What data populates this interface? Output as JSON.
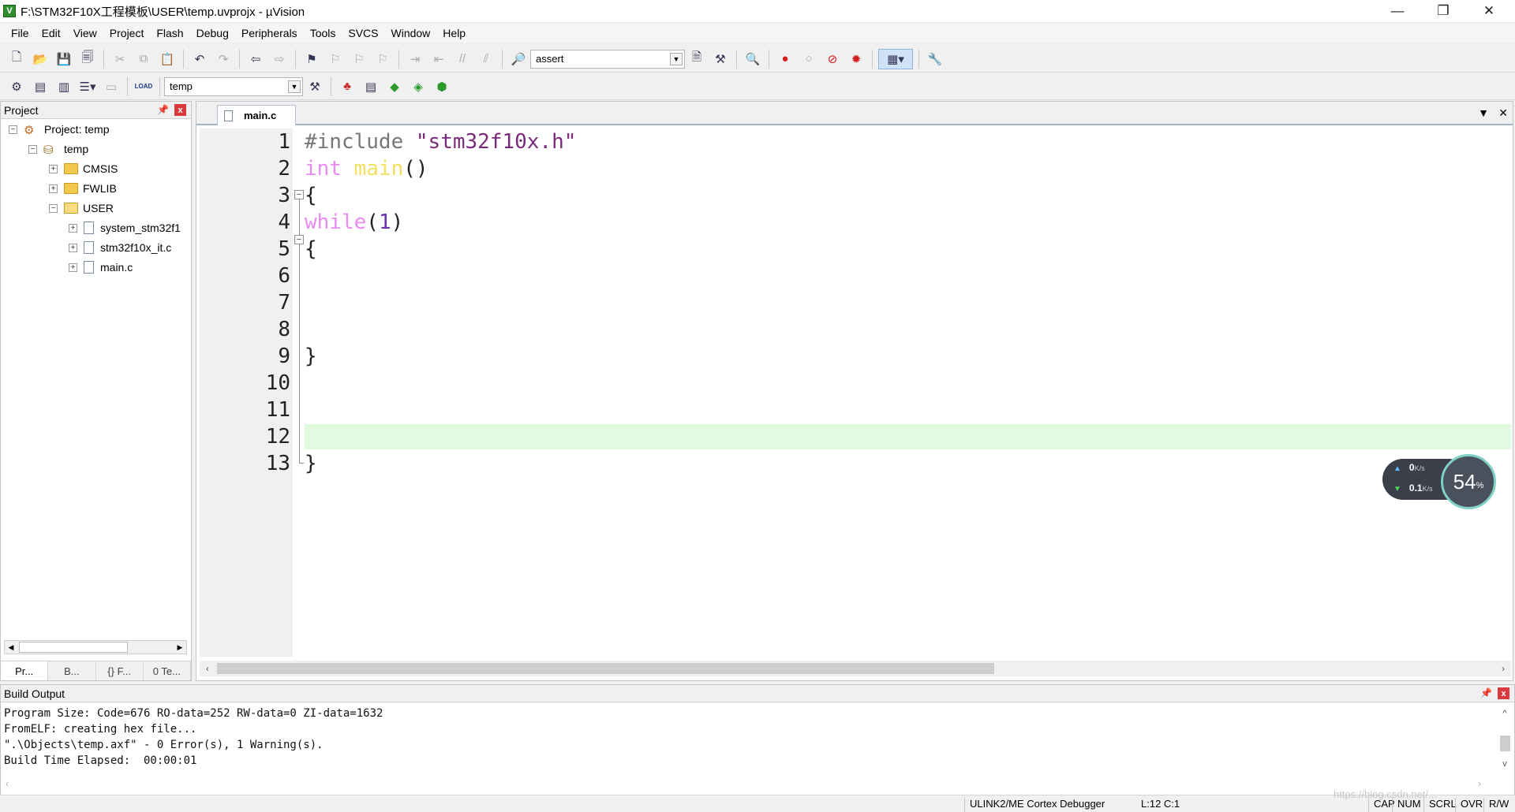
{
  "window": {
    "title": "F:\\STM32F10X工程模板\\USER\\temp.uvprojx - µVision",
    "minimize": "—",
    "maximize": "❐",
    "close": "✕"
  },
  "menu": [
    "File",
    "Edit",
    "View",
    "Project",
    "Flash",
    "Debug",
    "Peripherals",
    "Tools",
    "SVCS",
    "Window",
    "Help"
  ],
  "toolbar1": {
    "find_combo_value": "assert"
  },
  "toolbar2": {
    "target_combo_value": "temp",
    "load_label": "LOAD"
  },
  "project_panel": {
    "title": "Project",
    "pin": "📌",
    "close": "x",
    "root": "Project: temp",
    "target": "temp",
    "groups": [
      "CMSIS",
      "FWLIB",
      "USER"
    ],
    "user_files": [
      "system_stm32f1",
      "stm32f10x_it.c",
      "main.c"
    ],
    "tabs": [
      "Pr...",
      "B...",
      "{} F...",
      "0 Te..."
    ]
  },
  "editor": {
    "active_tab": "main.c",
    "line_numbers": [
      "1",
      "2",
      "3",
      "4",
      "5",
      "6",
      "7",
      "8",
      "9",
      "10",
      "11",
      "12",
      "13"
    ],
    "code": {
      "l1_pp": "#include",
      "l1_str": "\"stm32f10x.h\"",
      "l2_kw": "int",
      "l2_fn": "main",
      "l2_pun": "()",
      "l3": "{",
      "l4_kw": "while",
      "l4_open": "(",
      "l4_num": "1",
      "l4_close": ")",
      "l5": "{",
      "l9": "}",
      "l13": "}"
    }
  },
  "speed_widget": {
    "upload": "0",
    "upload_unit": "K/s",
    "download": "0.1",
    "download_unit": "K/s",
    "percent": "54",
    "percent_sign": "%"
  },
  "build_output": {
    "title": "Build Output",
    "lines": [
      "Program Size: Code=676 RO-data=252 RW-data=0 ZI-data=1632",
      "FromELF: creating hex file...",
      "\".\\Objects\\temp.axf\" - 0 Error(s), 1 Warning(s).",
      "Build Time Elapsed:  00:00:01"
    ]
  },
  "status_bar": {
    "debugger": "ULINK2/ME Cortex Debugger",
    "position": "L:12 C:1",
    "cap": "CAP",
    "num": "NUM",
    "scrl": "SCRL",
    "ovr": "OVR",
    "rw": "R/W"
  },
  "watermark": "https://blog.csdn.net/..."
}
